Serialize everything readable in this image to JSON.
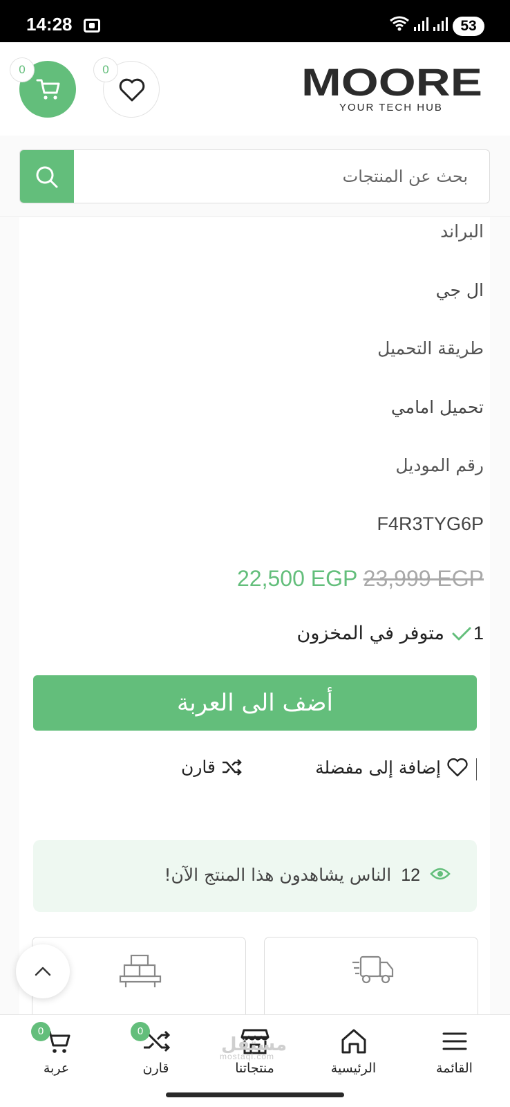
{
  "status_bar": {
    "time": "14:28",
    "battery": "53"
  },
  "header": {
    "cart_count": "0",
    "wishlist_count": "0",
    "logo_text": "MOORE",
    "logo_tagline": "YOUR TECH HUB"
  },
  "search": {
    "placeholder": "بحث عن المنتجات"
  },
  "specs": [
    {
      "label": "البراند",
      "value": "ال جي"
    },
    {
      "label": "طريقة التحميل",
      "value": "تحميل امامي"
    },
    {
      "label": "رقم الموديل",
      "value": "F4R3TYG6P"
    }
  ],
  "price": {
    "current": "22,500 EGP",
    "original": "23,999 EGP"
  },
  "stock": {
    "quantity": "1",
    "label": "متوفر في المخزون"
  },
  "actions": {
    "add_to_cart": "أضف الى العربة",
    "add_to_wishlist": "إضافة إلى مفضلة",
    "compare": "قارن"
  },
  "viewers": {
    "count": "12",
    "text": "الناس يشاهدون هذا المنتج الآن!"
  },
  "bottom_nav": {
    "menu": "القائمة",
    "home": "الرئيسية",
    "products": "منتجاتنا",
    "compare": "قارن",
    "compare_count": "0",
    "cart": "عربة",
    "cart_count": "0"
  },
  "watermark": {
    "arabic": "مستقل",
    "latin": "mostaql.com"
  },
  "colors": {
    "accent": "#63be7b",
    "text": "#222222",
    "muted": "#a8a8a8"
  }
}
